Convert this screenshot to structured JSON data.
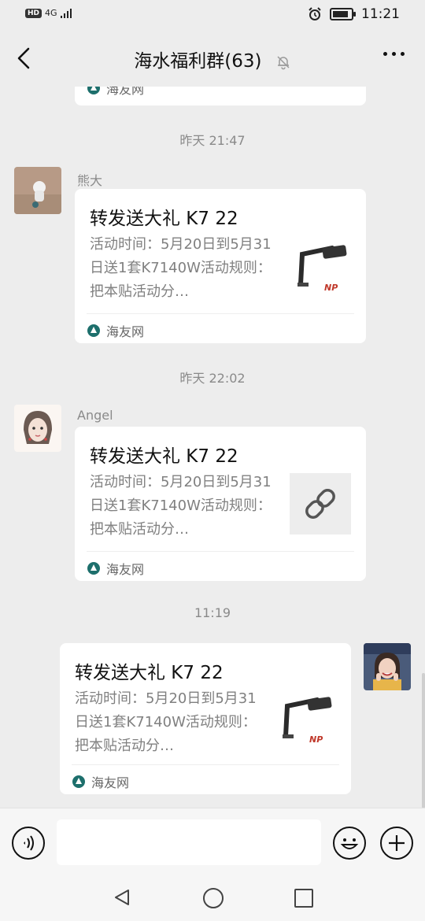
{
  "status": {
    "left_badge": "HD",
    "network": "4G",
    "time": "11:21"
  },
  "header": {
    "title": "海水福利群(63)"
  },
  "chat": {
    "top_partial_source": "海友网",
    "messages": [
      {
        "time": "昨天 21:47",
        "sender": "熊大",
        "title": "转发送大礼 K7 22",
        "desc": "活动时间：5月20日到5月31日送1套K7140W活动规则：把本贴活动分…",
        "source": "海友网",
        "thumb": "product-image"
      },
      {
        "time": "昨天 22:02",
        "sender": "Angel",
        "title": "转发送大礼 K7 22",
        "desc": "活动时间：5月20日到5月31日送1套K7140W活动规则：把本贴活动分…",
        "source": "海友网",
        "thumb": "link-icon"
      },
      {
        "time": "11:19",
        "sender": "",
        "title": "转发送大礼 K7 22",
        "desc": "活动时间：5月20日到5月31日送1套K7140W活动规则：把本贴活动分…",
        "source": "海友网",
        "thumb": "product-image"
      }
    ]
  },
  "input": {
    "placeholder": ""
  },
  "colors": {
    "background": "#ededed",
    "bubble": "#ffffff",
    "muted_text": "#8a8a8a",
    "source_icon": "#1d6f6c"
  }
}
